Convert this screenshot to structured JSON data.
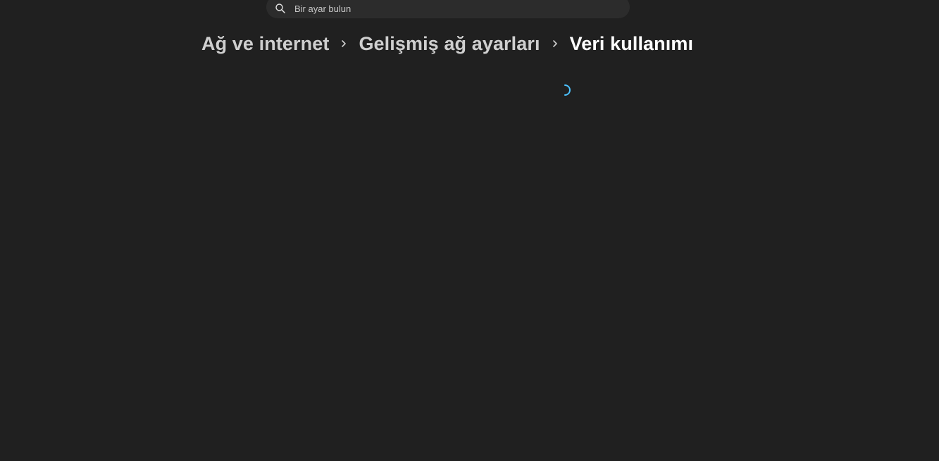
{
  "search": {
    "placeholder": "Bir ayar bulun"
  },
  "breadcrumb": {
    "items": [
      {
        "label": "Ağ ve internet"
      },
      {
        "label": "Gelişmiş ağ ayarları"
      },
      {
        "label": "Veri kullanımı"
      }
    ]
  },
  "icons": {
    "search": "search-icon",
    "separator": "chevron-right-icon",
    "loading": "loading-spinner-icon"
  },
  "colors": {
    "background": "#202020",
    "search_background": "#2c2c2c",
    "accent": "#4cc2ff",
    "breadcrumb_inactive": "#cfcfcf",
    "breadcrumb_current": "#ffffff"
  }
}
